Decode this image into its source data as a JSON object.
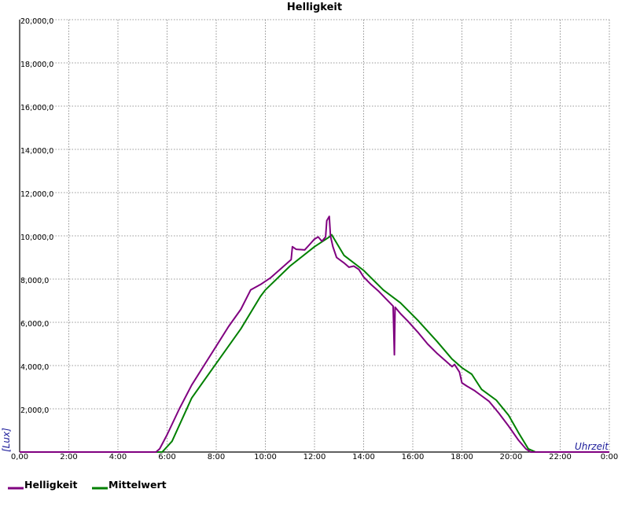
{
  "chart_data": {
    "type": "line",
    "title": "Helligkeit",
    "xlabel": "Uhrzeit",
    "ylabel": "[Lux]",
    "x_ticks": [
      "0,00",
      "2:00",
      "4:00",
      "6:00",
      "8:00",
      "10:00",
      "12:00",
      "14:00",
      "16:00",
      "18:00",
      "20:00",
      "22:00",
      "0:00"
    ],
    "y_ticks": [
      "2,000,0",
      "4,000,0",
      "6,000,0",
      "8,000,0",
      "10,000,0",
      "12,000,0",
      "14,000,0",
      "16,000,0",
      "18,000,0",
      "20,000,0"
    ],
    "x_unit": "hours",
    "xlim": [
      0,
      24
    ],
    "ylim": [
      0,
      20000
    ],
    "grid": true,
    "legend_position": "bottom-left",
    "series": [
      {
        "name": "Helligkeit",
        "color": "#800080",
        "points": [
          [
            0,
            0
          ],
          [
            5.55,
            0
          ],
          [
            5.7,
            150
          ],
          [
            6.0,
            800
          ],
          [
            6.5,
            2000
          ],
          [
            7.0,
            3100
          ],
          [
            7.5,
            4000
          ],
          [
            8.0,
            4900
          ],
          [
            8.5,
            5800
          ],
          [
            9.0,
            6600
          ],
          [
            9.4,
            7500
          ],
          [
            9.8,
            7750
          ],
          [
            10.2,
            8050
          ],
          [
            10.6,
            8450
          ],
          [
            10.9,
            8750
          ],
          [
            11.05,
            8900
          ],
          [
            11.1,
            9500
          ],
          [
            11.25,
            9380
          ],
          [
            11.6,
            9350
          ],
          [
            11.8,
            9600
          ],
          [
            12.0,
            9850
          ],
          [
            12.15,
            9950
          ],
          [
            12.3,
            9750
          ],
          [
            12.45,
            9950
          ],
          [
            12.5,
            10700
          ],
          [
            12.6,
            10900
          ],
          [
            12.65,
            10000
          ],
          [
            12.75,
            9500
          ],
          [
            12.9,
            9000
          ],
          [
            13.2,
            8750
          ],
          [
            13.4,
            8550
          ],
          [
            13.6,
            8600
          ],
          [
            13.8,
            8450
          ],
          [
            14.0,
            8100
          ],
          [
            14.3,
            7750
          ],
          [
            14.6,
            7450
          ],
          [
            14.9,
            7100
          ],
          [
            15.2,
            6750
          ],
          [
            15.25,
            4500
          ],
          [
            15.28,
            6700
          ],
          [
            15.5,
            6400
          ],
          [
            15.8,
            6050
          ],
          [
            16.2,
            5550
          ],
          [
            16.6,
            5000
          ],
          [
            17.0,
            4550
          ],
          [
            17.4,
            4150
          ],
          [
            17.6,
            3950
          ],
          [
            17.7,
            4050
          ],
          [
            17.9,
            3700
          ],
          [
            18.0,
            3200
          ],
          [
            18.2,
            3050
          ],
          [
            18.5,
            2850
          ],
          [
            18.8,
            2600
          ],
          [
            19.1,
            2350
          ],
          [
            19.5,
            1800
          ],
          [
            19.9,
            1200
          ],
          [
            20.3,
            550
          ],
          [
            20.6,
            150
          ],
          [
            20.8,
            0
          ],
          [
            24,
            0
          ]
        ]
      },
      {
        "name": "Mittelwert",
        "color": "#008000",
        "points": [
          [
            0,
            0
          ],
          [
            5.8,
            0
          ],
          [
            6.2,
            500
          ],
          [
            7.0,
            2500
          ],
          [
            8.0,
            4100
          ],
          [
            9.0,
            5700
          ],
          [
            9.8,
            7200
          ],
          [
            10.0,
            7500
          ],
          [
            11.0,
            8600
          ],
          [
            12.0,
            9500
          ],
          [
            12.6,
            9950
          ],
          [
            12.7,
            10050
          ],
          [
            13.2,
            9100
          ],
          [
            14.0,
            8400
          ],
          [
            14.8,
            7500
          ],
          [
            15.5,
            6900
          ],
          [
            16.2,
            6100
          ],
          [
            17.0,
            5100
          ],
          [
            17.6,
            4300
          ],
          [
            18.0,
            3900
          ],
          [
            18.4,
            3600
          ],
          [
            18.8,
            2900
          ],
          [
            19.4,
            2400
          ],
          [
            19.9,
            1700
          ],
          [
            20.3,
            900
          ],
          [
            20.7,
            150
          ],
          [
            21.0,
            0
          ],
          [
            24,
            0
          ]
        ]
      }
    ]
  }
}
